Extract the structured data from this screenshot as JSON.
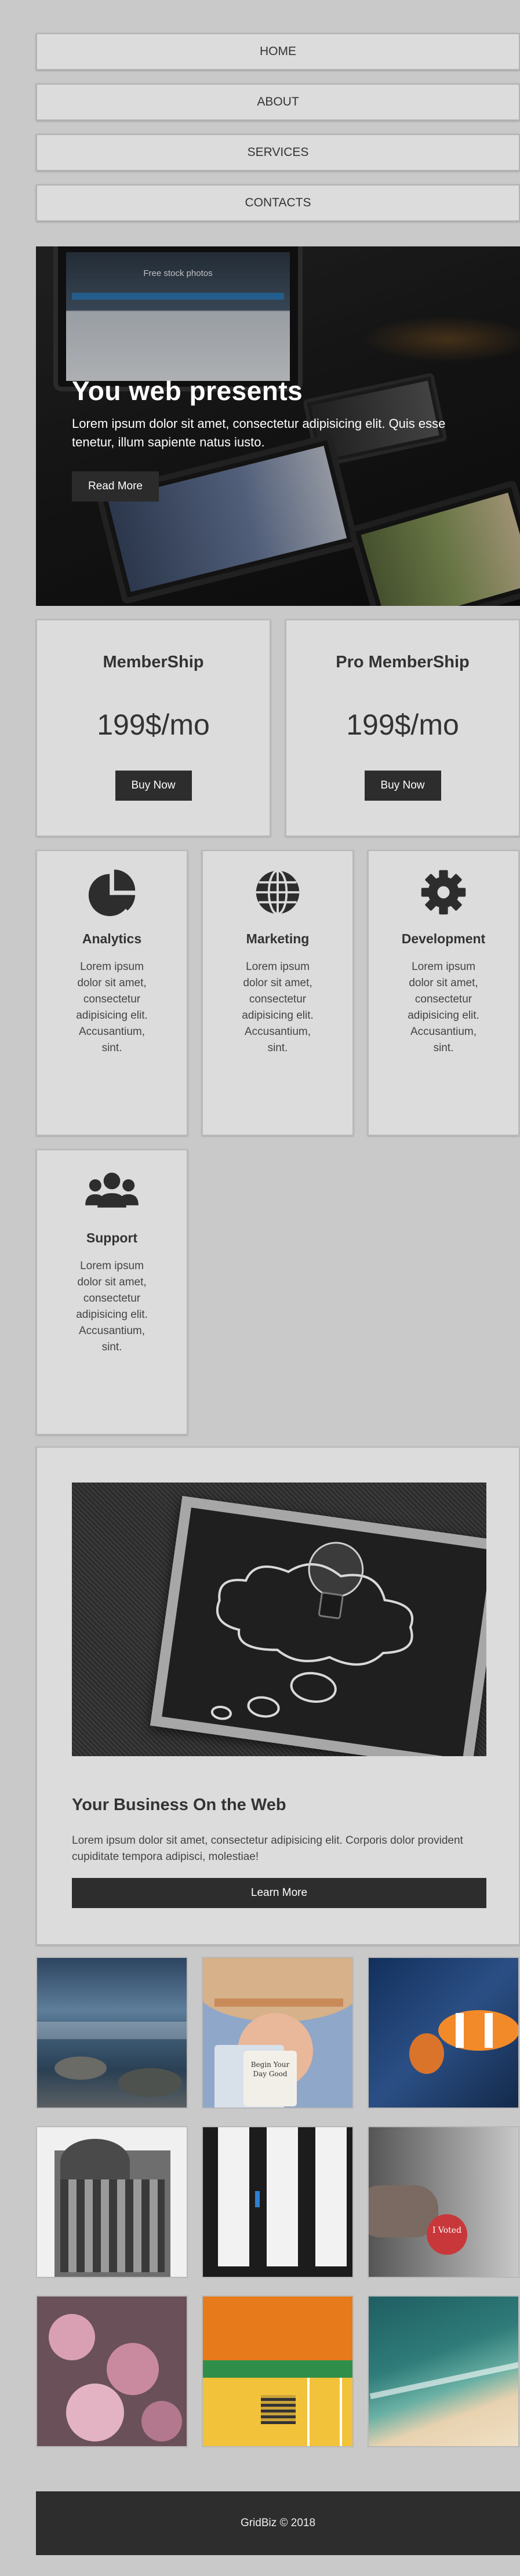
{
  "nav": {
    "items": [
      {
        "label": "HOME"
      },
      {
        "label": "ABOUT"
      },
      {
        "label": "SERVICES"
      },
      {
        "label": "CONTACTS"
      }
    ]
  },
  "hero": {
    "title": "You web presents",
    "text": "Lorem ipsum dolor sit amet, consectetur adipisicing elit. Quis esse tenetur, illum sapiente natus iusto.",
    "button": "Read More",
    "screen_text": "Free stock photos"
  },
  "pricing": [
    {
      "title": "MemberShip",
      "price": "199$/mo",
      "button": "Buy Now"
    },
    {
      "title": "Pro MemberShip",
      "price": "199$/mo",
      "button": "Buy Now"
    }
  ],
  "features": [
    {
      "title": "Analytics",
      "icon": "pie-chart-icon",
      "text": "Lorem ipsum dolor sit amet, consectetur adipisicing elit. Accusantium, sint."
    },
    {
      "title": "Marketing",
      "icon": "globe-icon",
      "text": "Lorem ipsum dolor sit amet, consectetur adipisicing elit. Accusantium, sint."
    },
    {
      "title": "Development",
      "icon": "gear-icon",
      "text": "Lorem ipsum dolor sit amet, consectetur adipisicing elit. Accusantium, sint."
    },
    {
      "title": "Support",
      "icon": "users-icon",
      "text": "Lorem ipsum dolor sit amet, consectetur adipisicing elit. Accusantium, sint."
    }
  ],
  "business": {
    "title": "Your Business On the Web",
    "text": "Lorem ipsum dolor sit amet, consectetur adipisicing elit. Corporis dolor provident cupiditate tempora adipisci, molestiae!",
    "button": "Learn More"
  },
  "gallery": {
    "images": [
      "ocean-rocks",
      "woman-hat-mug",
      "clownfish",
      "building",
      "doors",
      "voted-sticker",
      "pink-flowers",
      "colorful-wall",
      "beach-aerial"
    ],
    "mug_text": "Begin Your Day Good",
    "sticker_text": "I Voted"
  },
  "footer": {
    "text": "GridBiz © 2018"
  },
  "colors": {
    "background": "#c9c9c9",
    "card": "#dcdcdc",
    "button": "#2d2d2d"
  }
}
